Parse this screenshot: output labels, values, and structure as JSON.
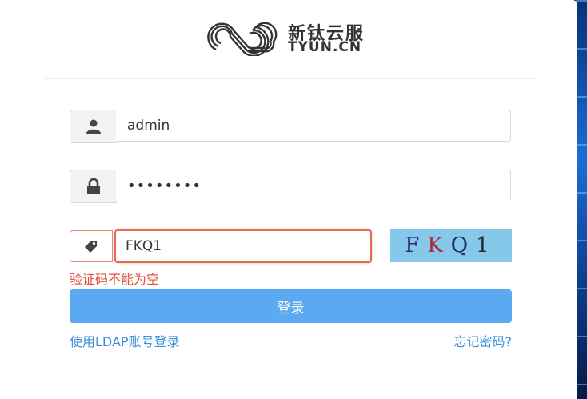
{
  "brand": {
    "name_cn": "新钛云服",
    "name_en": "TYUN.CN"
  },
  "form": {
    "username_value": "admin",
    "password_value": "••••••••",
    "captcha_value": "FKQ1",
    "captcha_chars": [
      "F",
      "K",
      "Q",
      "1"
    ],
    "captcha_error": "验证码不能为空",
    "login_label": "登录",
    "ldap_link": "使用LDAP账号登录",
    "forgot_link": "忘记密码?"
  },
  "icons": {
    "username": "user-icon",
    "password": "lock-icon",
    "captcha": "tag-icon"
  },
  "colors": {
    "primary": "#5ba9f0",
    "link": "#3a8fd9",
    "error": "#e2503a",
    "captcha_bg": "#86c8ea"
  }
}
